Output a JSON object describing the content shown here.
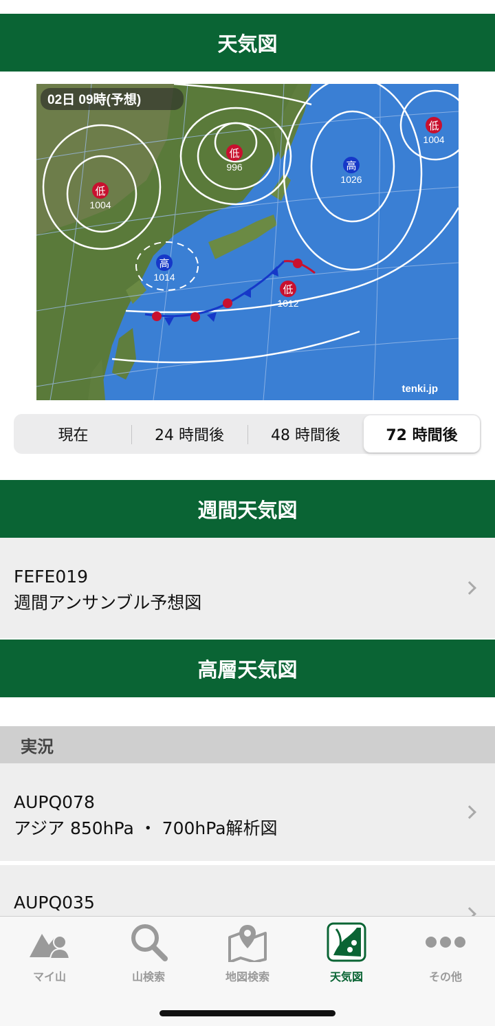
{
  "header": {
    "title": "天気図"
  },
  "map": {
    "timestamp": "02日 09時(予想)",
    "watermark": "tenki.jp",
    "pressure_labels": [
      {
        "kind": "低",
        "value": "996"
      },
      {
        "kind": "低",
        "value": "1004"
      },
      {
        "kind": "低",
        "value": "1004"
      },
      {
        "kind": "高",
        "value": "1026"
      },
      {
        "kind": "高",
        "value": "1014"
      },
      {
        "kind": "低",
        "value": "1012"
      }
    ]
  },
  "segments": [
    {
      "label": "現在",
      "active": false
    },
    {
      "label": "24 時間後",
      "active": false
    },
    {
      "label": "48 時間後",
      "active": false
    },
    {
      "label": "72 時間後",
      "active": true
    }
  ],
  "weekly": {
    "header": "週間天気図",
    "items": [
      {
        "code": "FEFE019",
        "title": "週間アンサンブル予想図"
      }
    ]
  },
  "upper": {
    "header": "高層天気図",
    "section": "実況",
    "items": [
      {
        "code": "AUPQ078",
        "title": "アジア 850hPa ・ 700hPa解析図"
      },
      {
        "code": "AUPQ035",
        "title": ""
      }
    ]
  },
  "tabbar": {
    "items": [
      {
        "label": "マイ山",
        "icon": "my-mountain-icon",
        "active": false
      },
      {
        "label": "山検索",
        "icon": "search-icon",
        "active": false
      },
      {
        "label": "地図検索",
        "icon": "map-pin-icon",
        "active": false
      },
      {
        "label": "天気図",
        "icon": "weather-map-icon",
        "active": true
      },
      {
        "label": "その他",
        "icon": "more-icon",
        "active": false
      }
    ]
  },
  "colors": {
    "brand_green": "#0a6434",
    "sea_blue": "#3a7fd4",
    "front_red": "#c8102e",
    "front_blue": "#1638c8"
  }
}
